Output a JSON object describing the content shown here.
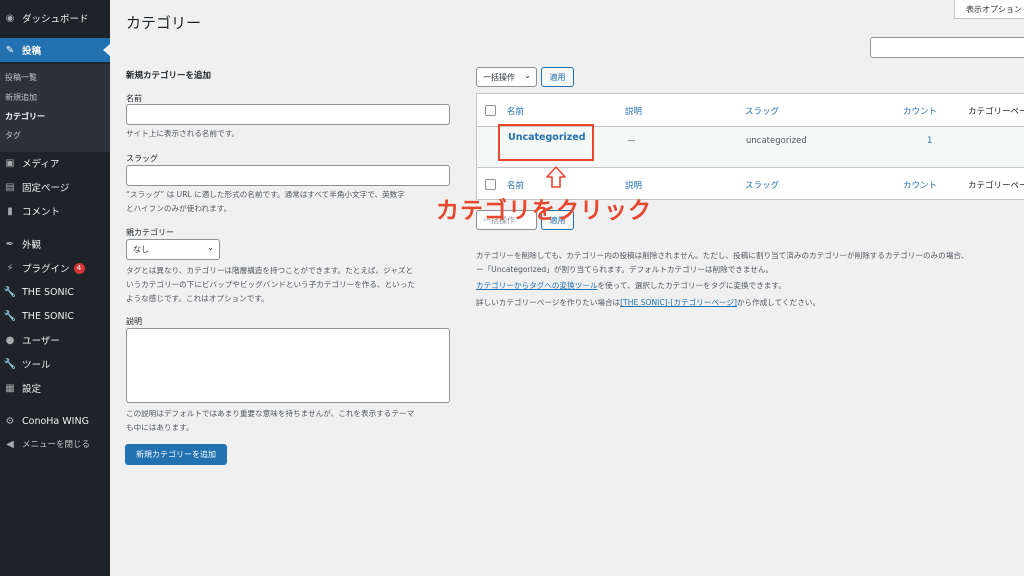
{
  "sidebar": {
    "items": [
      {
        "label": "ダッシュボード",
        "icon": "dashboard-icon",
        "glyph": "◉"
      },
      {
        "label": "投稿",
        "icon": "pin-icon",
        "glyph": "✎",
        "active": true
      },
      {
        "label": "メディア",
        "icon": "media-icon",
        "glyph": "▣"
      },
      {
        "label": "固定ページ",
        "icon": "page-icon",
        "glyph": "▤"
      },
      {
        "label": "コメント",
        "icon": "comment-icon",
        "glyph": "▮"
      },
      {
        "label": "外観",
        "icon": "brush-icon",
        "glyph": "✒"
      },
      {
        "label": "プラグイン",
        "icon": "plugin-icon",
        "glyph": "⚡",
        "badge": "4"
      },
      {
        "label": "THE SONIC",
        "icon": "wrench-icon",
        "glyph": "🔧"
      },
      {
        "label": "THE SONIC",
        "icon": "wrench-icon",
        "glyph": "🔧"
      },
      {
        "label": "ユーザー",
        "icon": "user-icon",
        "glyph": "●"
      },
      {
        "label": "ツール",
        "icon": "tool-icon",
        "glyph": "🔧"
      },
      {
        "label": "設定",
        "icon": "settings-icon",
        "glyph": "▦"
      },
      {
        "label": "ConoHa WING",
        "icon": "gear-icon",
        "glyph": "⚙"
      },
      {
        "label": "メニューを閉じる",
        "icon": "collapse-icon",
        "glyph": "◀"
      }
    ],
    "submenu": [
      "投稿一覧",
      "新規追加",
      "カテゴリー",
      "タグ"
    ],
    "badge": "4"
  },
  "header": {
    "title": "カテゴリー",
    "screen_options": "表示オプション"
  },
  "form": {
    "heading": "新規カテゴリーを追加",
    "name_label": "名前",
    "name_help": "サイト上に表示される名前です。",
    "slug_label": "スラッグ",
    "slug_help_1": "“スラッグ” は URL に適した形式の名前です。通常はすべて半角小文字で、英数字",
    "slug_help_2": "とハイフンのみが使われます。",
    "parent_label": "親カテゴリー",
    "parent_value": "なし",
    "parent_help_1": "タグとは異なり、カテゴリーは階層構造を持つことができます。たとえば、ジャズと",
    "parent_help_2": "いうカテゴリーの下にビバップやビッグバンドという子カテゴリーを作る、といった",
    "parent_help_3": "ような感じです。これはオプションです。",
    "desc_label": "説明",
    "desc_help_1": "この説明はデフォルトではあまり重要な意味を持ちませんが、これを表示するテーマ",
    "desc_help_2": "も中にはあります。",
    "submit": "新規カテゴリーを追加"
  },
  "table": {
    "bulk_label": "一括操作",
    "apply": "適用",
    "headers": {
      "name": "名前",
      "desc": "説明",
      "slug": "スラッグ",
      "count": "カウント",
      "page": "カテゴリーペー"
    },
    "rows": [
      {
        "name": "Uncategorized",
        "desc": "—",
        "slug": "uncategorized",
        "count": "1"
      }
    ]
  },
  "annotation": "カテゴリをクリック",
  "notes": {
    "line1": "カテゴリーを削除しても、カテゴリー内の投稿は削除されません。ただし、投稿に割り当て済みのカテゴリーが削除するカテゴリーのみの場合、",
    "line2": "ー「Uncategorized」が割り当てられます。デフォルトカテゴリーは削除できません。",
    "line3_link": "カテゴリーからタグへの変換ツール",
    "line3_rest": "を使って、選択したカテゴリーをタグに変換できます。",
    "line4_pre": "詳しいカテゴリーページを作りたい場合は",
    "line4_link": "[THE SONIC]-[カテゴリーページ]",
    "line4_post": "から作成してください。"
  },
  "colors": {
    "accent": "#2271b1",
    "sidebar": "#1d2327",
    "annotation": "#e8462d"
  }
}
